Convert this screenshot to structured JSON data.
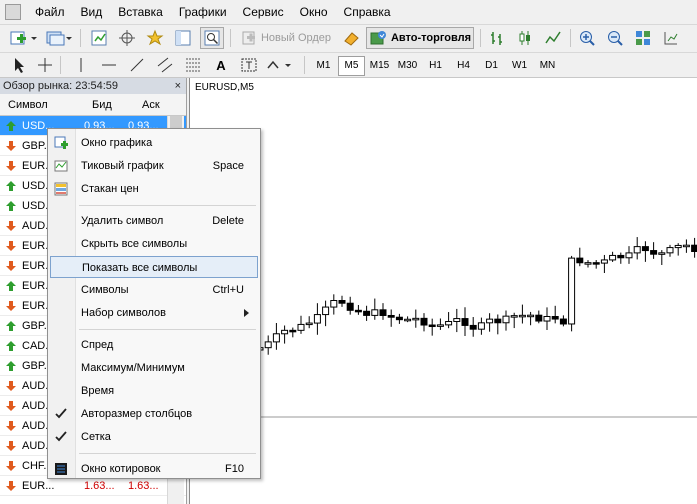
{
  "menubar": {
    "items": [
      "Файл",
      "Вид",
      "Вставка",
      "Графики",
      "Сервис",
      "Окно",
      "Справка"
    ]
  },
  "toolbar": {
    "new_order_label": "Новый Ордер",
    "autotrading_label": "Авто-торговля",
    "timeframes": [
      "M1",
      "M5",
      "M15",
      "M30",
      "H1",
      "H4",
      "D1",
      "W1",
      "MN"
    ],
    "selected_timeframe": "M5",
    "text_tool_label": "A"
  },
  "market_watch": {
    "title": "Обзор рынка: 23:54:59",
    "close": "×",
    "columns": {
      "symbol": "Символ",
      "bid": "Бид",
      "ask": "Аск"
    },
    "rows": [
      {
        "symbol": "USD...",
        "bid": "0.93...",
        "ask": "0.93...",
        "dir": "up",
        "selected": true
      },
      {
        "symbol": "GBP...",
        "bid": "",
        "ask": "",
        "dir": "down"
      },
      {
        "symbol": "EUR...",
        "bid": "",
        "ask": "",
        "dir": "down"
      },
      {
        "symbol": "USD...",
        "bid": "",
        "ask": "",
        "dir": "up"
      },
      {
        "symbol": "USD...",
        "bid": "",
        "ask": "",
        "dir": "up"
      },
      {
        "symbol": "AUD...",
        "bid": "",
        "ask": "",
        "dir": "down"
      },
      {
        "symbol": "EUR...",
        "bid": "",
        "ask": "",
        "dir": "down"
      },
      {
        "symbol": "EUR...",
        "bid": "",
        "ask": "",
        "dir": "down"
      },
      {
        "symbol": "EUR...",
        "bid": "",
        "ask": "",
        "dir": "up"
      },
      {
        "symbol": "EUR...",
        "bid": "",
        "ask": "",
        "dir": "down"
      },
      {
        "symbol": "GBP...",
        "bid": "",
        "ask": "",
        "dir": "up"
      },
      {
        "symbol": "CAD...",
        "bid": "",
        "ask": "",
        "dir": "up"
      },
      {
        "symbol": "GBP...",
        "bid": "",
        "ask": "",
        "dir": "up"
      },
      {
        "symbol": "AUD...",
        "bid": "",
        "ask": "",
        "dir": "down"
      },
      {
        "symbol": "AUD...",
        "bid": "",
        "ask": "",
        "dir": "down"
      },
      {
        "symbol": "AUD...",
        "bid": "",
        "ask": "",
        "dir": "down"
      },
      {
        "symbol": "AUD...",
        "bid": "",
        "ask": "",
        "dir": "down"
      },
      {
        "symbol": "CHF...",
        "bid": "",
        "ask": "",
        "dir": "down"
      },
      {
        "symbol": "EUR...",
        "bid": "1.63...",
        "ask": "1.63...",
        "dir": "down"
      }
    ]
  },
  "chart": {
    "title": "EURUSD,M5"
  },
  "context_menu": {
    "items": [
      {
        "label": "Окно графика",
        "shortcut": "",
        "icon": "new-chart-icon"
      },
      {
        "label": "Тиковый график",
        "shortcut": "Space",
        "icon": "tick-chart-icon"
      },
      {
        "label": "Стакан цен",
        "shortcut": "",
        "icon": "depth-of-market-icon"
      },
      {
        "label": "Удалить символ",
        "shortcut": "Delete",
        "icon": ""
      },
      {
        "label": "Скрыть все символы",
        "shortcut": "",
        "icon": ""
      },
      {
        "label": "Показать все символы",
        "shortcut": "",
        "icon": "",
        "highlighted": true
      },
      {
        "label": "Символы",
        "shortcut": "Ctrl+U",
        "icon": ""
      },
      {
        "label": "Набор символов",
        "shortcut": "",
        "icon": "",
        "submenu": true
      },
      {
        "label": "Спред",
        "shortcut": "",
        "icon": ""
      },
      {
        "label": "Максимум/Минимум",
        "shortcut": "",
        "icon": ""
      },
      {
        "label": "Время",
        "shortcut": "",
        "icon": ""
      },
      {
        "label": "Авторазмер столбцов",
        "shortcut": "",
        "icon": "checkmark-icon"
      },
      {
        "label": "Сетка",
        "shortcut": "",
        "icon": "checkmark-icon"
      },
      {
        "label": "Окно котировок",
        "shortcut": "F10",
        "icon": "quote-window-icon"
      }
    ]
  },
  "colors": {
    "up_arrow": "#2e9e2e",
    "down_arrow": "#e05a1e",
    "selection": "#3399ff",
    "price_red": "#d00000"
  }
}
